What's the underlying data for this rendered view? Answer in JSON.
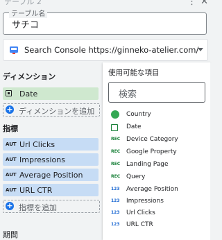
{
  "header": {
    "title": "テーブル 2",
    "icons": [
      "more-vert-icon",
      "close-icon"
    ]
  },
  "name_field": {
    "label": "テーブル名",
    "value": "サチコ"
  },
  "data_source": {
    "icon": "search-console-icon",
    "label": "Search Console https://ginneko-atelier.com/"
  },
  "dimensions": {
    "title": "ディメンション",
    "items": [
      {
        "type": "date",
        "label": "Date"
      }
    ],
    "add_label": "ディメンションを追加"
  },
  "metrics": {
    "title": "指標",
    "items": [
      {
        "tag": "AUT",
        "label": "Url Clicks"
      },
      {
        "tag": "AUT",
        "label": "Impressions"
      },
      {
        "tag": "AUT",
        "label": "Average Position"
      },
      {
        "tag": "AUT",
        "label": "URL CTR"
      }
    ],
    "add_label": "指標を追加"
  },
  "period": {
    "title": "期間"
  },
  "available_fields": {
    "title": "使用可能な項目",
    "search_placeholder": "検索",
    "items": [
      {
        "type": "geo",
        "tag": "",
        "label": "Country"
      },
      {
        "type": "date",
        "tag": "",
        "label": "Date"
      },
      {
        "type": "text",
        "tag": "REC",
        "label": "Device Category"
      },
      {
        "type": "text",
        "tag": "REC",
        "label": "Google Property"
      },
      {
        "type": "text",
        "tag": "REC",
        "label": "Landing Page"
      },
      {
        "type": "text",
        "tag": "REC",
        "label": "Query"
      },
      {
        "type": "num",
        "tag": "123",
        "label": "Average Position"
      },
      {
        "type": "num",
        "tag": "123",
        "label": "Impressions"
      },
      {
        "type": "num",
        "tag": "123",
        "label": "Url Clicks"
      },
      {
        "type": "num",
        "tag": "123",
        "label": "URL CTR"
      }
    ]
  }
}
